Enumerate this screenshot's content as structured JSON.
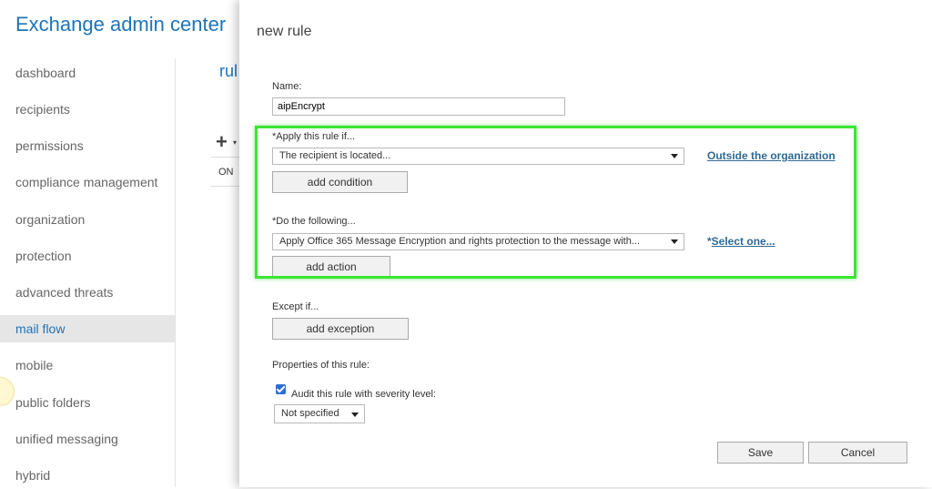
{
  "app": {
    "title": "Exchange admin center"
  },
  "sidebar": {
    "items": [
      {
        "label": "dashboard"
      },
      {
        "label": "recipients"
      },
      {
        "label": "permissions"
      },
      {
        "label": "compliance management"
      },
      {
        "label": "organization"
      },
      {
        "label": "protection"
      },
      {
        "label": "advanced threats"
      },
      {
        "label": "mail flow",
        "active": true
      },
      {
        "label": "mobile"
      },
      {
        "label": "public folders"
      },
      {
        "label": "unified messaging"
      },
      {
        "label": "hybrid"
      }
    ]
  },
  "background": {
    "rules_title_partial": "rul",
    "add_icon": "+",
    "column_on": "ON"
  },
  "dialog": {
    "title": "new rule",
    "name_label": "Name:",
    "name_value": "aipEncrypt",
    "apply_label": "*Apply this rule if...",
    "apply_select": "The recipient is located...",
    "apply_link": "Outside the organization",
    "add_condition": "add condition",
    "do_label": "*Do the following...",
    "do_select": "Apply Office 365 Message Encryption and rights protection to the message with...",
    "do_link_prefix": "*",
    "do_link": "Select one...",
    "add_action": "add action",
    "except_label": "Except if...",
    "add_exception": "add exception",
    "properties_label": "Properties of this rule:",
    "audit_label": "Audit this rule with severity level:",
    "audit_checked": true,
    "severity_value": "Not specified",
    "save": "Save",
    "cancel": "Cancel"
  },
  "colors": {
    "accent": "#1e74b9",
    "highlight": "#3be633",
    "link": "#2f6a94"
  }
}
